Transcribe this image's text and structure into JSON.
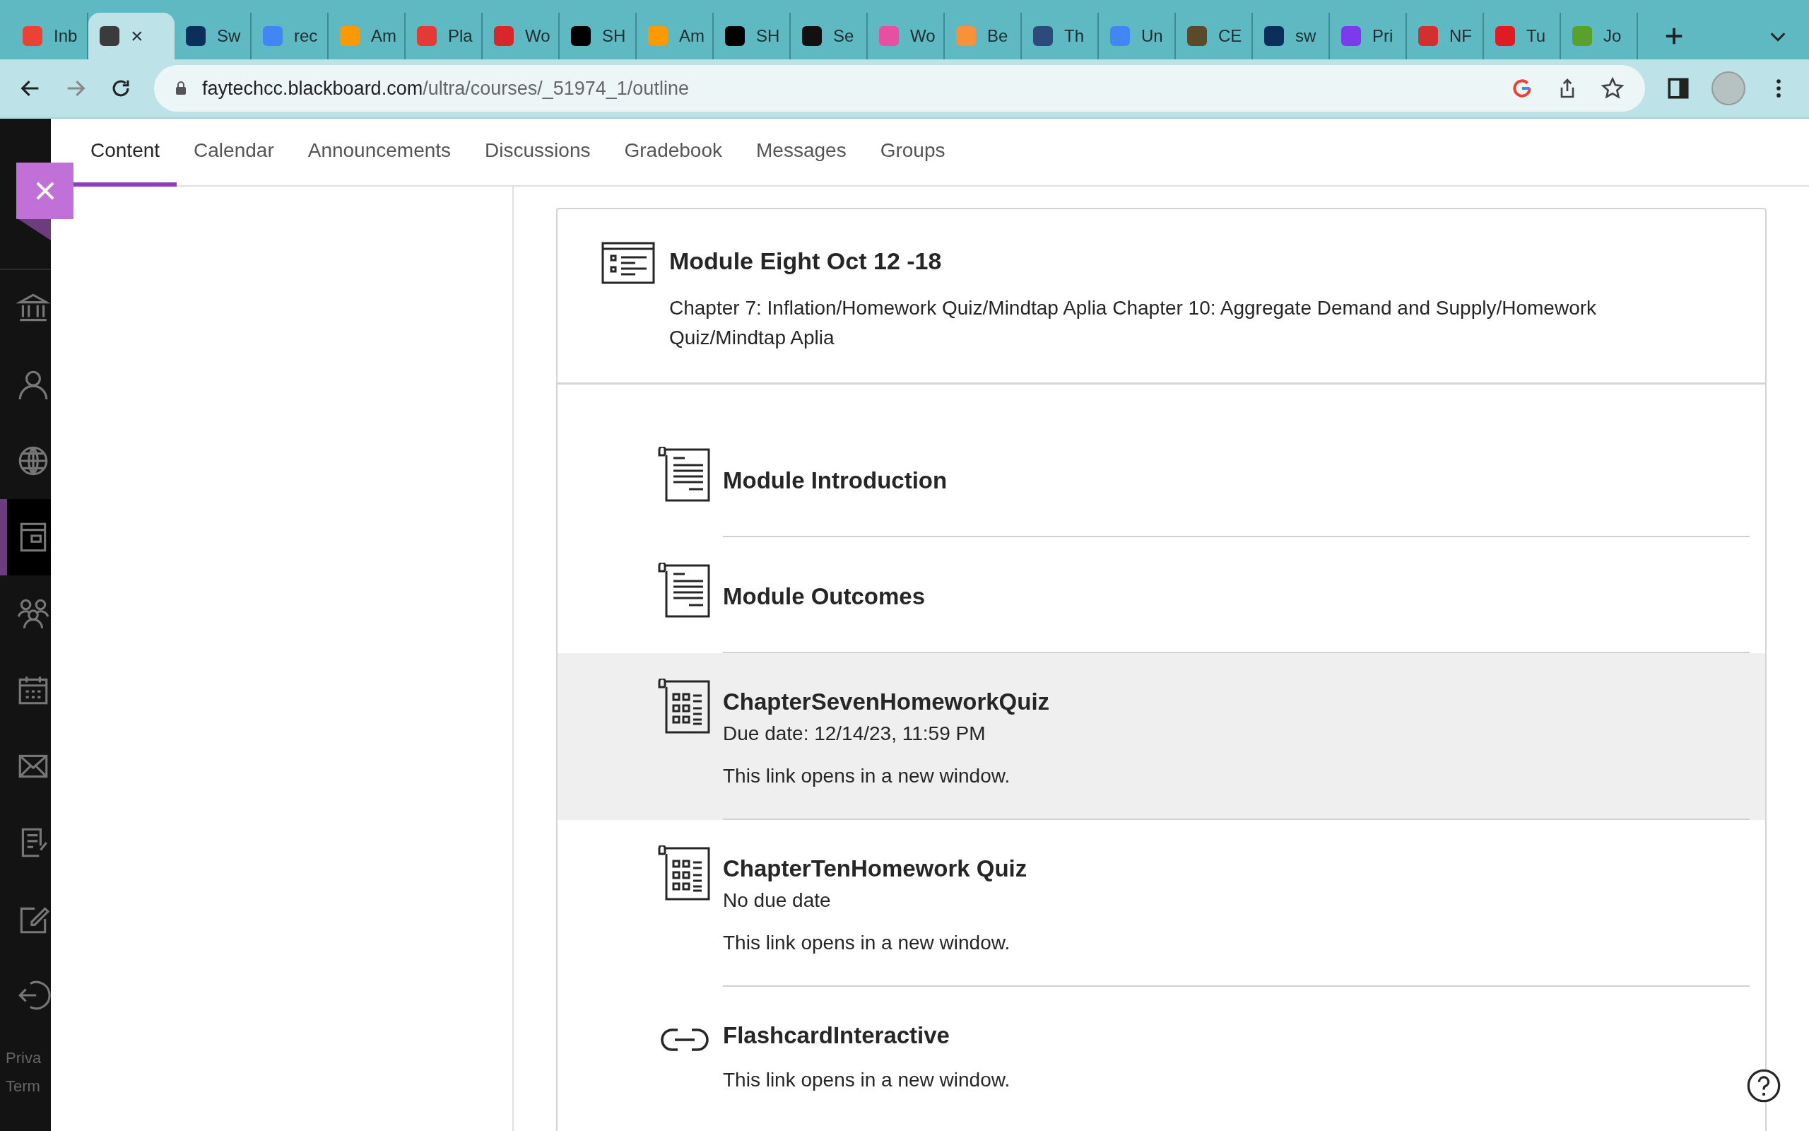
{
  "browser": {
    "tabs": [
      {
        "label": "Inb",
        "selected": false,
        "color": "#ea4335"
      },
      {
        "label": "×",
        "selected": true,
        "color": "#3b3b3b"
      },
      {
        "label": "Sw",
        "selected": false,
        "color": "#0b2e5b"
      },
      {
        "label": "rec",
        "selected": false,
        "color": "#4285f4"
      },
      {
        "label": "Am",
        "selected": false,
        "color": "#ff9900"
      },
      {
        "label": "Pla",
        "selected": false,
        "color": "#e53935"
      },
      {
        "label": "Wo",
        "selected": false,
        "color": "#d9262b"
      },
      {
        "label": "SH",
        "selected": false,
        "color": "#000000"
      },
      {
        "label": "Am",
        "selected": false,
        "color": "#ff9900"
      },
      {
        "label": "SH",
        "selected": false,
        "color": "#000000"
      },
      {
        "label": "Se",
        "selected": false,
        "color": "#111111"
      },
      {
        "label": "Wo",
        "selected": false,
        "color": "#e84fa0"
      },
      {
        "label": "Be",
        "selected": false,
        "color": "#f7923a"
      },
      {
        "label": "Th",
        "selected": false,
        "color": "#2c4a7a"
      },
      {
        "label": "Un",
        "selected": false,
        "color": "#4285f4"
      },
      {
        "label": "CE",
        "selected": false,
        "color": "#5a4a2a"
      },
      {
        "label": "sw",
        "selected": false,
        "color": "#0b2e5b"
      },
      {
        "label": "Pri",
        "selected": false,
        "color": "#7c3aed"
      },
      {
        "label": "NF",
        "selected": false,
        "color": "#d32f2f"
      },
      {
        "label": "Tu",
        "selected": false,
        "color": "#e01b22"
      },
      {
        "label": "Jo",
        "selected": false,
        "color": "#5aa02c"
      }
    ],
    "url": {
      "host": "faytechcc.blackboard.com",
      "path": "/ultra/courses/_51974_1/outline"
    }
  },
  "sidebar": {
    "items": [
      {
        "kind": "institution",
        "selected": false
      },
      {
        "kind": "profile",
        "selected": false
      },
      {
        "kind": "globe",
        "selected": false
      },
      {
        "kind": "courses",
        "selected": true
      },
      {
        "kind": "groups",
        "selected": false
      },
      {
        "kind": "calendar",
        "selected": false
      },
      {
        "kind": "messages",
        "selected": false
      },
      {
        "kind": "grades",
        "selected": false
      },
      {
        "kind": "tools",
        "selected": false
      },
      {
        "kind": "signout",
        "selected": false
      }
    ],
    "footer": [
      "Priva",
      "Term"
    ]
  },
  "course_tabs": [
    {
      "label": "Content",
      "selected": true
    },
    {
      "label": "Calendar",
      "selected": false
    },
    {
      "label": "Announcements",
      "selected": false
    },
    {
      "label": "Discussions",
      "selected": false
    },
    {
      "label": "Gradebook",
      "selected": false
    },
    {
      "label": "Messages",
      "selected": false
    },
    {
      "label": "Groups",
      "selected": false
    }
  ],
  "module": {
    "title": "Module Eight Oct 12 -18",
    "description": "Chapter 7: Inflation/Homework Quiz/Mindtap Aplia Chapter 10: Aggregate Demand and Supply/Homework Quiz/Mindtap Aplia",
    "items": [
      {
        "kind": "document",
        "title": "Module Introduction",
        "highlighted": false
      },
      {
        "kind": "document",
        "title": "Module Outcomes",
        "highlighted": false
      },
      {
        "kind": "assessment",
        "title": "ChapterSevenHomeworkQuiz",
        "due": "Due date: 12/14/23, 11:59 PM",
        "note": "This link opens in a new window.",
        "highlighted": true
      },
      {
        "kind": "assessment",
        "title": "ChapterTenHomework Quiz",
        "due": "No due date",
        "note": "This link opens in a new window.",
        "highlighted": false
      },
      {
        "kind": "link",
        "title": "FlashcardInteractive",
        "note": "This link opens in a new window.",
        "highlighted": false
      }
    ]
  }
}
